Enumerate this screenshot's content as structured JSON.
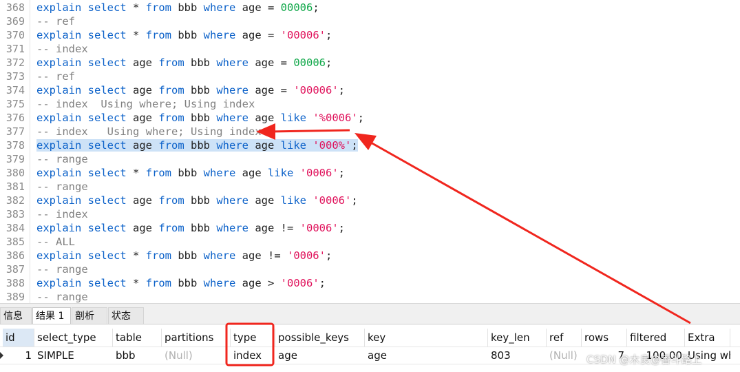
{
  "editor": {
    "lines": [
      {
        "n": "368",
        "tokens": [
          [
            "kw",
            "explain select"
          ],
          [
            "id",
            " * "
          ],
          [
            "kw",
            "from"
          ],
          [
            "id",
            " bbb "
          ],
          [
            "kw",
            "where"
          ],
          [
            "id",
            " age = "
          ],
          [
            "num",
            "00006"
          ],
          [
            "id",
            ";"
          ]
        ]
      },
      {
        "n": "369",
        "tokens": [
          [
            "com",
            "-- ref"
          ]
        ]
      },
      {
        "n": "370",
        "tokens": [
          [
            "kw",
            "explain select"
          ],
          [
            "id",
            " * "
          ],
          [
            "kw",
            "from"
          ],
          [
            "id",
            " bbb "
          ],
          [
            "kw",
            "where"
          ],
          [
            "id",
            " age = "
          ],
          [
            "str",
            "'00006'"
          ],
          [
            "id",
            ";"
          ]
        ]
      },
      {
        "n": "371",
        "tokens": [
          [
            "com",
            "-- index"
          ]
        ]
      },
      {
        "n": "372",
        "tokens": [
          [
            "kw",
            "explain select"
          ],
          [
            "id",
            " age "
          ],
          [
            "kw",
            "from"
          ],
          [
            "id",
            " bbb "
          ],
          [
            "kw",
            "where"
          ],
          [
            "id",
            " age = "
          ],
          [
            "num",
            "00006"
          ],
          [
            "id",
            ";"
          ]
        ]
      },
      {
        "n": "373",
        "tokens": [
          [
            "com",
            "-- ref"
          ]
        ]
      },
      {
        "n": "374",
        "tokens": [
          [
            "kw",
            "explain select"
          ],
          [
            "id",
            " age "
          ],
          [
            "kw",
            "from"
          ],
          [
            "id",
            " bbb "
          ],
          [
            "kw",
            "where"
          ],
          [
            "id",
            " age = "
          ],
          [
            "str",
            "'00006'"
          ],
          [
            "id",
            ";"
          ]
        ]
      },
      {
        "n": "375",
        "tokens": [
          [
            "com",
            "-- index  Using where; Using index"
          ]
        ]
      },
      {
        "n": "376",
        "tokens": [
          [
            "kw",
            "explain select"
          ],
          [
            "id",
            " age "
          ],
          [
            "kw",
            "from"
          ],
          [
            "id",
            " bbb "
          ],
          [
            "kw",
            "where"
          ],
          [
            "id",
            " age "
          ],
          [
            "kw",
            "like"
          ],
          [
            "id",
            " "
          ],
          [
            "str",
            "'%0006'"
          ],
          [
            "id",
            ";"
          ]
        ]
      },
      {
        "n": "377",
        "tokens": [
          [
            "com",
            "-- index   Using where; Using index"
          ]
        ]
      },
      {
        "n": "378",
        "highlight": true,
        "tokens": [
          [
            "kw",
            "explain select"
          ],
          [
            "id",
            " age "
          ],
          [
            "kw",
            "from"
          ],
          [
            "id",
            " bbb "
          ],
          [
            "kw",
            "where"
          ],
          [
            "id",
            " age "
          ],
          [
            "kw",
            "like"
          ],
          [
            "id",
            " "
          ],
          [
            "str",
            "'000%'"
          ],
          [
            "id",
            ";"
          ]
        ]
      },
      {
        "n": "379",
        "tokens": [
          [
            "com",
            "-- range"
          ]
        ]
      },
      {
        "n": "380",
        "tokens": [
          [
            "kw",
            "explain select"
          ],
          [
            "id",
            " * "
          ],
          [
            "kw",
            "from"
          ],
          [
            "id",
            " bbb "
          ],
          [
            "kw",
            "where"
          ],
          [
            "id",
            " age "
          ],
          [
            "kw",
            "like"
          ],
          [
            "id",
            " "
          ],
          [
            "str",
            "'0006'"
          ],
          [
            "id",
            ";"
          ]
        ]
      },
      {
        "n": "381",
        "tokens": [
          [
            "com",
            "-- range"
          ]
        ]
      },
      {
        "n": "382",
        "tokens": [
          [
            "kw",
            "explain select"
          ],
          [
            "id",
            " age "
          ],
          [
            "kw",
            "from"
          ],
          [
            "id",
            " bbb "
          ],
          [
            "kw",
            "where"
          ],
          [
            "id",
            " age "
          ],
          [
            "kw",
            "like"
          ],
          [
            "id",
            " "
          ],
          [
            "str",
            "'0006'"
          ],
          [
            "id",
            ";"
          ]
        ]
      },
      {
        "n": "383",
        "tokens": [
          [
            "com",
            "-- index"
          ]
        ]
      },
      {
        "n": "384",
        "tokens": [
          [
            "kw",
            "explain select"
          ],
          [
            "id",
            " age "
          ],
          [
            "kw",
            "from"
          ],
          [
            "id",
            " bbb "
          ],
          [
            "kw",
            "where"
          ],
          [
            "id",
            " age != "
          ],
          [
            "str",
            "'0006'"
          ],
          [
            "id",
            ";"
          ]
        ]
      },
      {
        "n": "385",
        "tokens": [
          [
            "com",
            "-- ALL"
          ]
        ]
      },
      {
        "n": "386",
        "tokens": [
          [
            "kw",
            "explain select"
          ],
          [
            "id",
            " * "
          ],
          [
            "kw",
            "from"
          ],
          [
            "id",
            " bbb "
          ],
          [
            "kw",
            "where"
          ],
          [
            "id",
            " age != "
          ],
          [
            "str",
            "'0006'"
          ],
          [
            "id",
            ";"
          ]
        ]
      },
      {
        "n": "387",
        "tokens": [
          [
            "com",
            "-- range"
          ]
        ]
      },
      {
        "n": "388",
        "tokens": [
          [
            "kw",
            "explain select"
          ],
          [
            "id",
            " * "
          ],
          [
            "kw",
            "from"
          ],
          [
            "id",
            " bbb "
          ],
          [
            "kw",
            "where"
          ],
          [
            "id",
            " age > "
          ],
          [
            "str",
            "'0006'"
          ],
          [
            "id",
            ";"
          ]
        ]
      },
      {
        "n": "389",
        "tokens": [
          [
            "com",
            "-- range"
          ]
        ]
      }
    ]
  },
  "tabs": [
    {
      "label": "信息",
      "active": false
    },
    {
      "label": "结果 1",
      "active": true
    },
    {
      "label": "剖析",
      "active": false
    },
    {
      "label": "状态",
      "active": false
    }
  ],
  "grid": {
    "columns": [
      "id",
      "select_type",
      "table",
      "partitions",
      "type",
      "possible_keys",
      "key",
      "key_len",
      "ref",
      "rows",
      "filtered",
      "Extra"
    ],
    "row": {
      "id": "1",
      "select_type": "SIMPLE",
      "table": "bbb",
      "partitions": "(Null)",
      "type": "index",
      "possible_keys": "age",
      "key": "age",
      "key_len": "803",
      "ref": "(Null)",
      "rows": "7",
      "filtered": "100.00",
      "Extra": "Using wh"
    }
  },
  "annotations": {
    "color": "#f0261e"
  },
  "watermark": "CSDN @木良@香斗路上",
  "colors": {
    "keyword": "#0b61c9",
    "number": "#11a84a",
    "string": "#e0105a",
    "comment": "#808080",
    "selection": "#cde2f7"
  }
}
